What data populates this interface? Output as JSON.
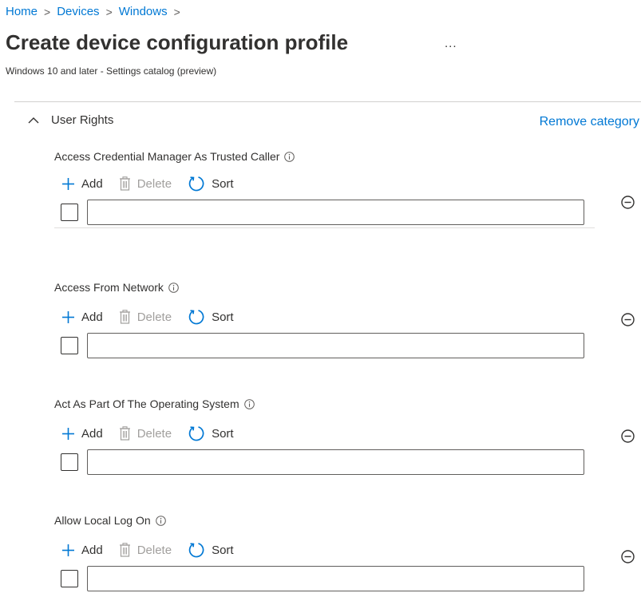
{
  "breadcrumb": {
    "items": [
      "Home",
      "Devices",
      "Windows"
    ],
    "separator": ">"
  },
  "page": {
    "title": "Create device configuration profile",
    "more": "...",
    "subtitle": "Windows 10 and later - Settings catalog (preview)"
  },
  "category": {
    "name": "User Rights",
    "remove_label": "Remove category",
    "expanded": true
  },
  "toolbar": {
    "add_label": "Add",
    "delete_label": "Delete",
    "sort_label": "Sort",
    "delete_enabled": false
  },
  "settings": [
    {
      "label": "Access Credential Manager As Trusted Caller",
      "value": "",
      "checked": false
    },
    {
      "label": "Access From Network",
      "value": "",
      "checked": false
    },
    {
      "label": "Act As Part Of The Operating System",
      "value": "",
      "checked": false
    },
    {
      "label": "Allow Local Log On",
      "value": "",
      "checked": false
    }
  ],
  "colors": {
    "accent": "#0078d4",
    "text": "#323130",
    "disabled": "#a19f9d",
    "divider": "#d2d0ce"
  },
  "icons": {
    "add": "plus-icon",
    "delete": "trash-icon",
    "sort": "refresh-icon",
    "info": "info-icon",
    "remove": "minus-circle-icon",
    "collapse": "chevron-up-icon"
  }
}
